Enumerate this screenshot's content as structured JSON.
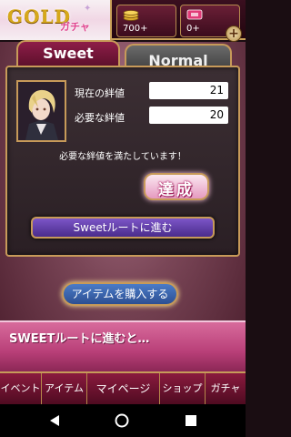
{
  "header": {
    "banner_title": "GOLD",
    "banner_subtitle": "ガチャ",
    "coins": "700+",
    "tickets": "0+",
    "plus_label": "+"
  },
  "tabs": {
    "sweet": "Sweet",
    "normal": "Normal"
  },
  "stats": {
    "current_label": "現在の絆値",
    "current_value": "21",
    "required_label": "必要な絆値",
    "required_value": "20",
    "message": "必要な絆値を満たしています！"
  },
  "badge": "達成",
  "buttons": {
    "sweet_route": "Sweetルートに進む",
    "buy_items": "アイテムを購入する"
  },
  "promo": "SWEETルートに進むと…",
  "bottom_nav": [
    "イベント",
    "アイテム",
    "マイページ",
    "ショップ",
    "ガチャ"
  ],
  "colors": {
    "accent_gold": "#c79a59",
    "primary_purple": "#4a2c8c",
    "primary_wine": "#5a0f2a"
  },
  "icons": {
    "coin": "coin-stack-icon",
    "ticket": "ticket-icon",
    "back": "triangle-back-icon",
    "home": "circle-home-icon",
    "recent": "square-recent-icon"
  }
}
